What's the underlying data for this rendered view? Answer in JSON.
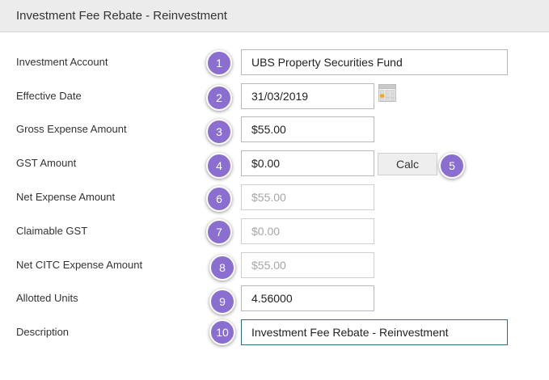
{
  "header": {
    "title": "Investment Fee Rebate - Reinvestment"
  },
  "form": {
    "investment_account": {
      "label": "Investment Account",
      "badge": "1",
      "value": "UBS Property Securities Fund"
    },
    "effective_date": {
      "label": "Effective Date",
      "badge": "2",
      "value": "31/03/2019"
    },
    "gross_expense": {
      "label": "Gross Expense Amount",
      "badge": "3",
      "value": "$55.00"
    },
    "gst_amount": {
      "label": "GST Amount",
      "badge": "4",
      "value": "$0.00",
      "calc_label": "Calc",
      "calc_badge": "5"
    },
    "net_expense": {
      "label": "Net Expense Amount",
      "badge": "6",
      "value": "$55.00"
    },
    "claimable_gst": {
      "label": "Claimable GST",
      "badge": "7",
      "value": "$0.00"
    },
    "net_citc_expense": {
      "label": "Net CITC Expense Amount",
      "badge": "8",
      "value": "$55.00"
    },
    "allotted_units": {
      "label": "Allotted Units",
      "badge": "9",
      "value": "4.56000"
    },
    "description": {
      "label": "Description",
      "badge": "10",
      "value": "Investment Fee Rebate - Reinvestment"
    }
  },
  "icons": {
    "calendar": "calendar-icon"
  },
  "colors": {
    "badge": "#8a6fd0",
    "header_bg": "#ececec",
    "focus_border": "#2a6f7a",
    "disabled_text": "#a6a6a6"
  }
}
